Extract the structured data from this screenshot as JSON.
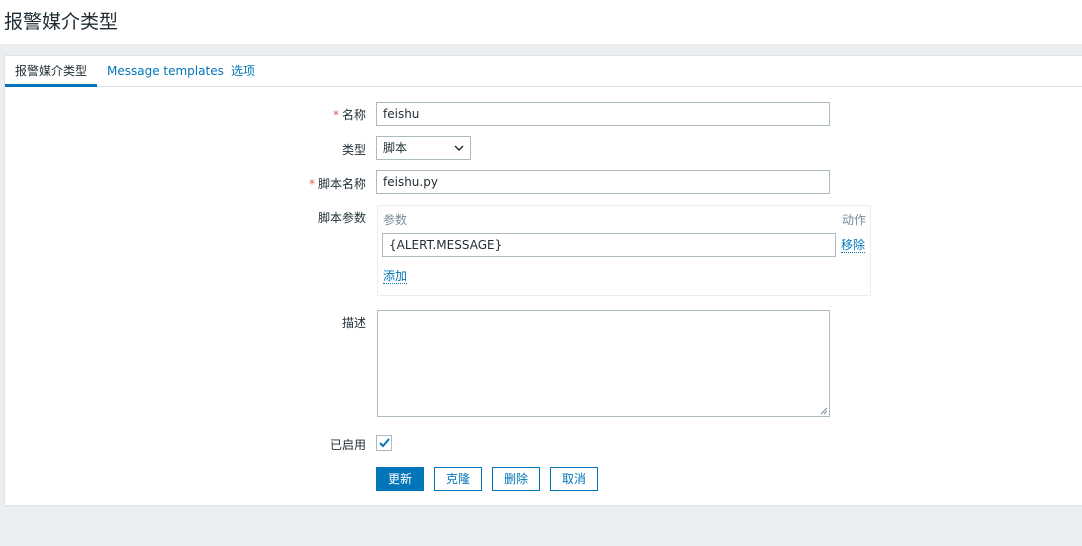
{
  "page": {
    "title": "报警媒介类型"
  },
  "tabs": [
    {
      "label": "报警媒介类型",
      "active": true
    },
    {
      "label": "Message templates",
      "active": false
    },
    {
      "label": "选项",
      "active": false
    }
  ],
  "form": {
    "name": {
      "required_mark": "*",
      "label": "名称",
      "value": "feishu"
    },
    "type": {
      "label": "类型",
      "selected": "脚本"
    },
    "script_name": {
      "required_mark": "*",
      "label": "脚本名称",
      "value": "feishu.py"
    },
    "script_params": {
      "label": "脚本参数",
      "col_param": "参数",
      "col_action": "动作",
      "rows": [
        {
          "value": "{ALERT.MESSAGE}",
          "remove_label": "移除"
        }
      ],
      "add_label": "添加"
    },
    "description": {
      "label": "描述",
      "value": ""
    },
    "enabled": {
      "label": "已启用",
      "checked": true
    }
  },
  "buttons": {
    "update": "更新",
    "clone": "克隆",
    "delete": "删除",
    "cancel": "取消"
  },
  "colors": {
    "accent": "#0275b8",
    "required": "#e45959",
    "background": "#ebeef0"
  },
  "icons": {
    "select": "chevron-down-icon",
    "checkbox": "checkmark-icon",
    "textarea": "resize-grip-icon"
  }
}
